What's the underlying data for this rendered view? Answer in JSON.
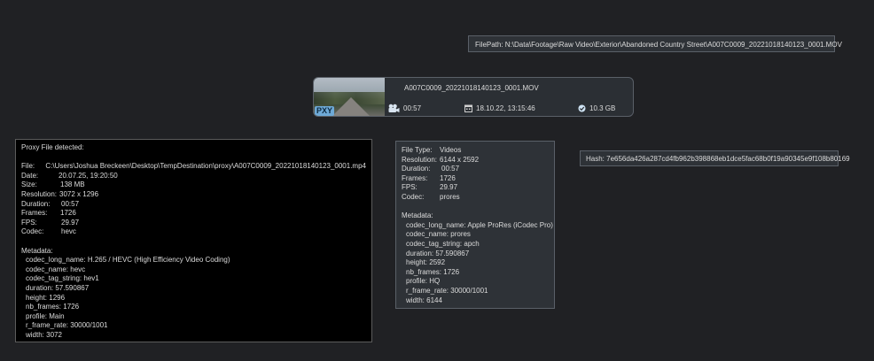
{
  "filepath_tooltip": "FilePath: N:\\Data\\Footage\\Raw Video\\Exterior\\Abandoned Country Street\\A007C0009_20221018140123_0001.MOV",
  "hash_tooltip": "Hash: 7e656da426a287cd4fb962b398868eb1dce5fac68b0f19a90345e9f108b80169",
  "card": {
    "badge": "PXY",
    "filename": "A007C0009_20221018140123_0001.MOV",
    "duration": "00:57",
    "date": "18.10.22,  13:15:46",
    "size": "10.3 GB",
    "duration_icon": "video-camera-icon",
    "date_icon": "calendar-icon",
    "size_icon": "check-circle-icon"
  },
  "proxy": {
    "heading": "Proxy File detected:",
    "fields": [
      {
        "k": "File:",
        "v": "C:\\Users\\Joshua Breckeen\\Desktop\\TempDestination\\proxy\\A007C0009_20221018140123_0001.mp4"
      },
      {
        "k": "Date:",
        "v": "20.07.25,  19:20:50"
      },
      {
        "k": "Size:",
        "v": "138 MB"
      },
      {
        "k": "Resolution:",
        "v": "3072 x 1296"
      },
      {
        "k": "Duration:",
        "v": "00:57"
      },
      {
        "k": "Frames:",
        "v": "1726"
      },
      {
        "k": "FPS:",
        "v": "29.97"
      },
      {
        "k": "Codec:",
        "v": "hevc"
      }
    ],
    "metadata_label": "Metadata:",
    "metadata": [
      "codec_long_name: H.265 / HEVC (High Efficiency Video Coding)",
      "codec_name: hevc",
      "codec_tag_string: hev1",
      "duration: 57.590867",
      "height: 1296",
      "nb_frames: 1726",
      "profile: Main",
      "r_frame_rate: 30000/1001",
      "width: 3072"
    ]
  },
  "source": {
    "fields": [
      {
        "k": "File Type:",
        "v": "Videos"
      },
      {
        "k": "Resolution:",
        "v": "6144 x 2592"
      },
      {
        "k": "Duration:",
        "v": "00:57"
      },
      {
        "k": "Frames:",
        "v": "1726"
      },
      {
        "k": "FPS:",
        "v": "29.97"
      },
      {
        "k": "Codec:",
        "v": "prores"
      }
    ],
    "metadata_label": "Metadata:",
    "metadata": [
      "codec_long_name: Apple ProRes (iCodec Pro)",
      "codec_name: prores",
      "codec_tag_string: apch",
      "duration: 57.590867",
      "height: 2592",
      "nb_frames: 1726",
      "profile: HQ",
      "r_frame_rate: 30000/1001",
      "width: 6144"
    ]
  }
}
